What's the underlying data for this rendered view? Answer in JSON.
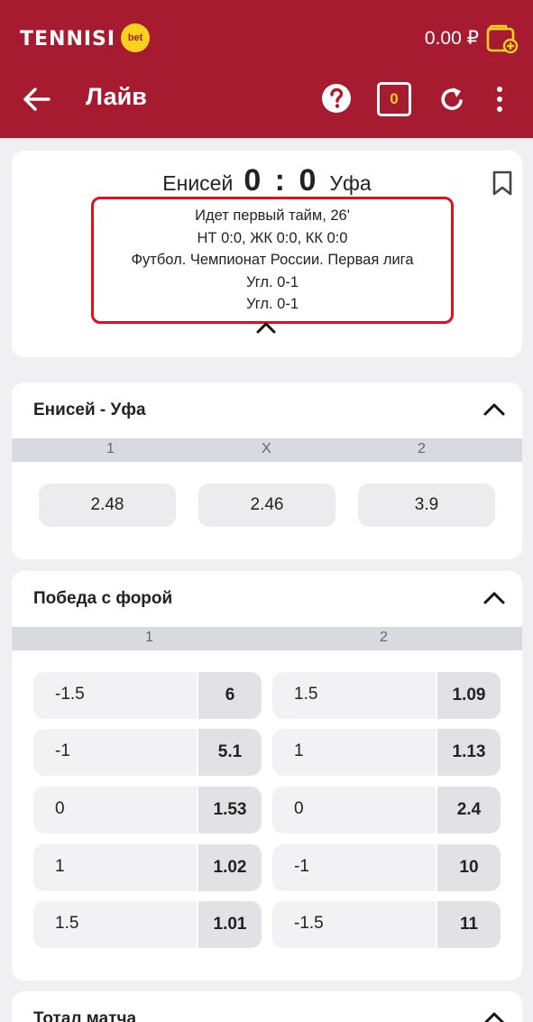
{
  "header": {
    "brand": "TENNISI",
    "brand_badge": "bet",
    "balance": "0.00 ₽",
    "title": "Лайв",
    "coupon_count": "0",
    "bg_color": "#a71b30"
  },
  "match": {
    "team1": "Енисей",
    "score": "0 : 0",
    "team2": "Уфа",
    "info_lines": [
      "Идет первый тайм, 26'",
      "НТ 0:0, ЖК 0:0, КК 0:0",
      "Футбол. Чемпионат России. Первая лига",
      "Угл. 0-1",
      "Угл. 0-1"
    ]
  },
  "market_main": {
    "title": "Енисей - Уфа",
    "headers": [
      "1",
      "X",
      "2"
    ],
    "odds": [
      "2.48",
      "2.46",
      "3.9"
    ]
  },
  "market_handicap": {
    "title": "Победа с форой",
    "headers": [
      "1",
      "2"
    ],
    "rows": [
      {
        "h1": "-1.5",
        "o1": "6",
        "h2": "1.5",
        "o2": "1.09"
      },
      {
        "h1": "-1",
        "o1": "5.1",
        "h2": "1",
        "o2": "1.13"
      },
      {
        "h1": "0",
        "o1": "1.53",
        "h2": "0",
        "o2": "2.4"
      },
      {
        "h1": "1",
        "o1": "1.02",
        "h2": "-1",
        "o2": "10"
      },
      {
        "h1": "1.5",
        "o1": "1.01",
        "h2": "-1.5",
        "o2": "11"
      }
    ]
  },
  "market_total": {
    "title": "Тотал матча"
  }
}
